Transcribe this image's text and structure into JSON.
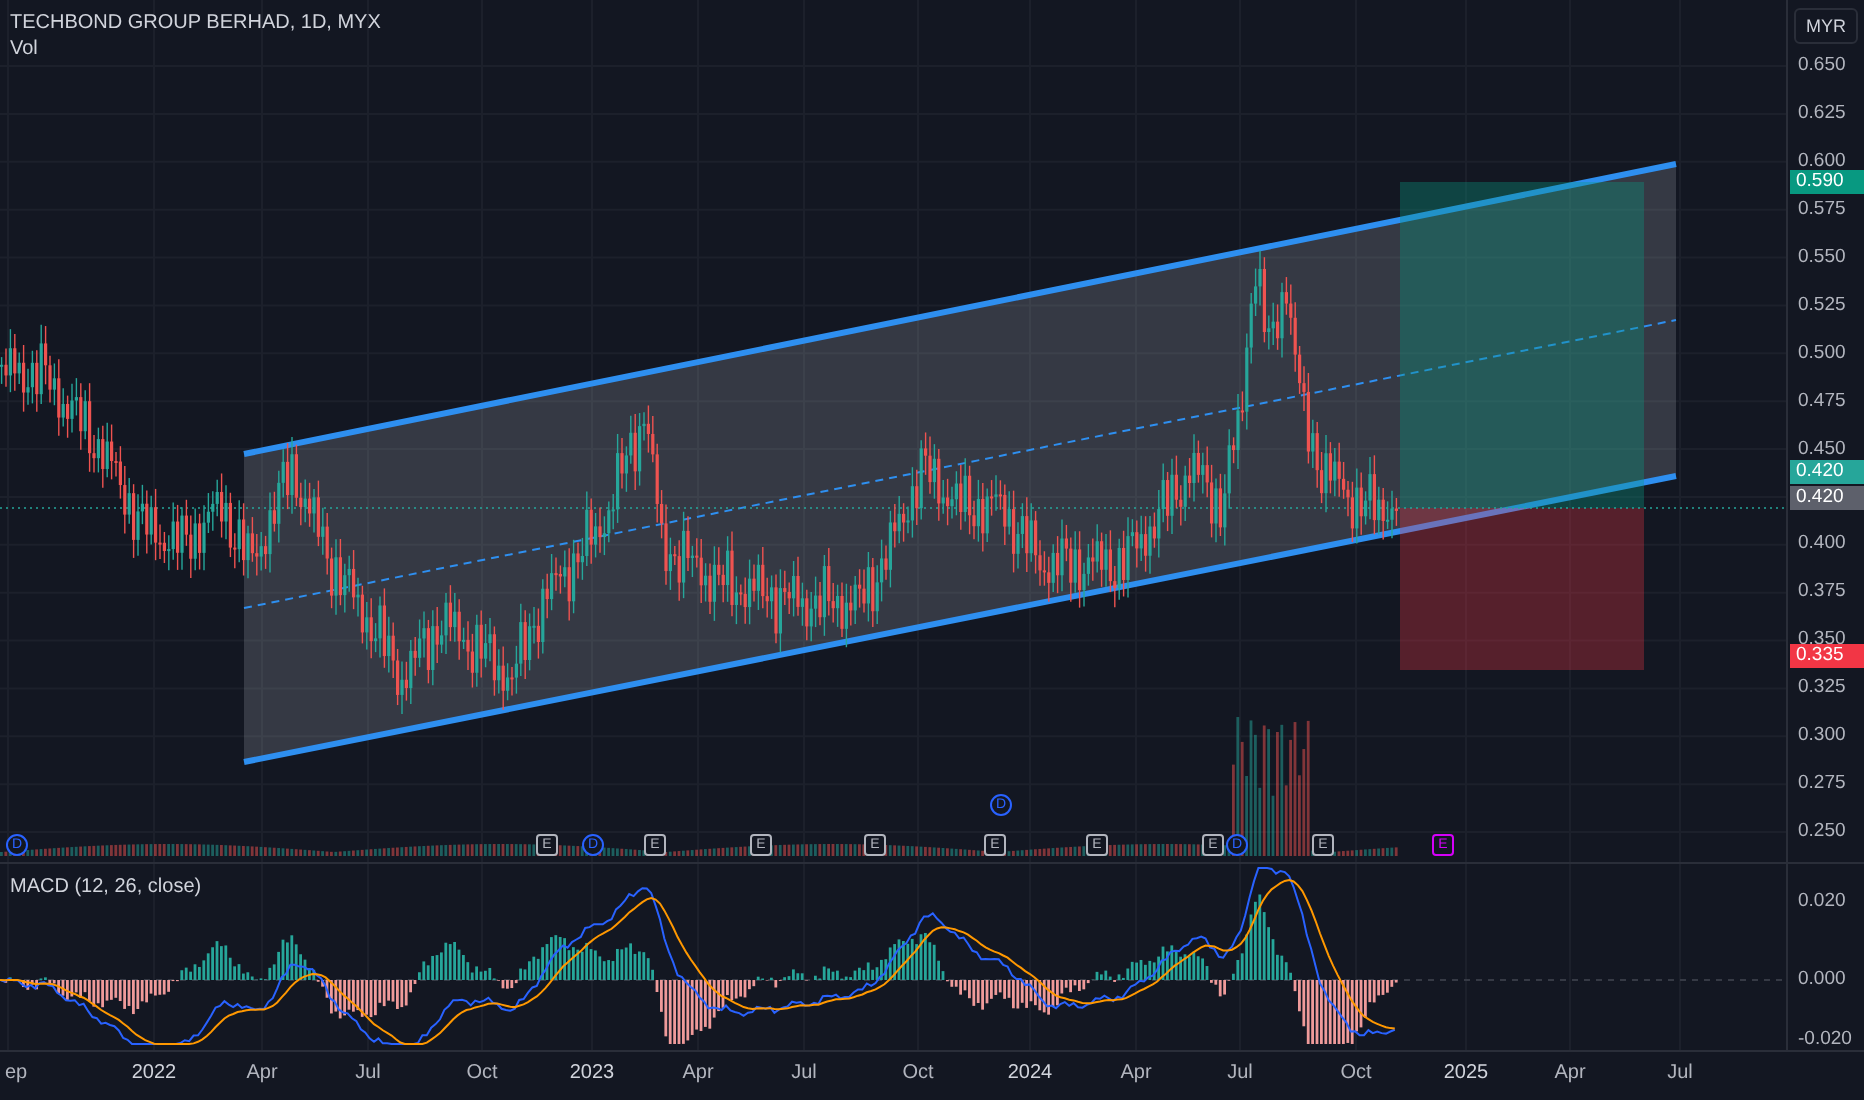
{
  "legend": {
    "title": "TECHBOND GROUP BERHAD, 1D, MYX",
    "volume_label": "Vol"
  },
  "currency_button": "MYR",
  "price_axis": [
    "0.650",
    "0.625",
    "0.600",
    "0.575",
    "0.550",
    "0.525",
    "0.500",
    "0.475",
    "0.450",
    "0.400",
    "0.375",
    "0.350",
    "0.325",
    "0.300",
    "0.275",
    "0.250"
  ],
  "price_tags": [
    {
      "text": "0.590",
      "color": "#089981"
    },
    {
      "text": "0.420",
      "color": "#26a69a"
    },
    {
      "text": "0.420",
      "color": "#5d606b"
    },
    {
      "text": "0.335",
      "color": "#f23645"
    }
  ],
  "events": [
    {
      "kind": "dividend",
      "label": "D",
      "color": "#2962ff"
    },
    {
      "kind": "earnings",
      "label": "E",
      "color": "#b2b5be"
    },
    {
      "kind": "dividend",
      "label": "D",
      "color": "#2962ff"
    },
    {
      "kind": "earnings",
      "label": "E",
      "color": "#b2b5be"
    },
    {
      "kind": "earnings",
      "label": "E",
      "color": "#b2b5be"
    },
    {
      "kind": "earnings",
      "label": "E",
      "color": "#b2b5be"
    },
    {
      "kind": "dividend",
      "label": "D",
      "color": "#2962ff"
    },
    {
      "kind": "earnings",
      "label": "E",
      "color": "#b2b5be"
    },
    {
      "kind": "earnings",
      "label": "E",
      "color": "#b2b5be"
    },
    {
      "kind": "earnings",
      "label": "E",
      "color": "#b2b5be"
    },
    {
      "kind": "dividend",
      "label": "D",
      "color": "#2962ff"
    },
    {
      "kind": "earnings",
      "label": "E",
      "color": "#b2b5be"
    },
    {
      "kind": "earnings",
      "label": "E",
      "color": "#d500f9"
    }
  ],
  "macd": {
    "label": "MACD (12, 26, close)",
    "axis": [
      "0.020",
      "0.000",
      "-0.020"
    ]
  },
  "time_axis": [
    "ep",
    "2022",
    "Apr",
    "Jul",
    "Oct",
    "2023",
    "Apr",
    "Jul",
    "Oct",
    "2024",
    "Apr",
    "Jul",
    "Oct",
    "2025",
    "Apr",
    "Jul"
  ]
}
